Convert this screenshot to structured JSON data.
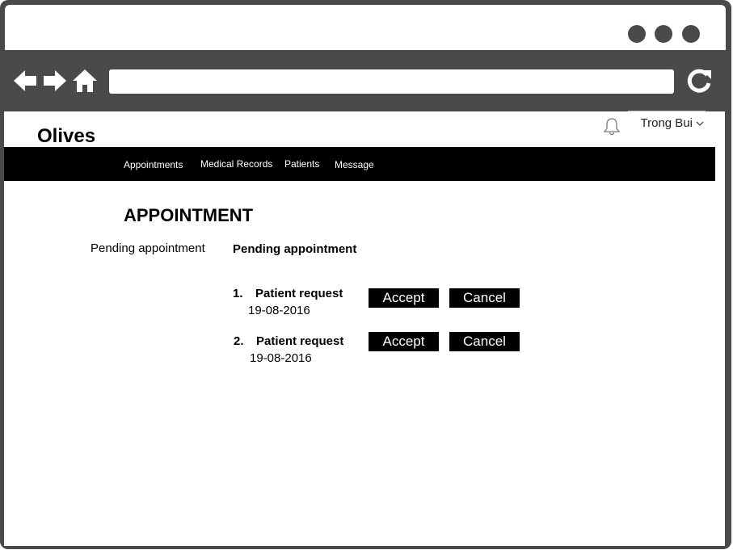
{
  "browser": {
    "window_dots": 3,
    "url_value": ""
  },
  "app": {
    "logo": "Olives",
    "user_name": "Trong Bui",
    "nav": [
      "Appointments",
      "Medical Records",
      "Patients",
      "Message"
    ]
  },
  "page": {
    "title": "APPOINTMENT",
    "side_label": "Pending appointment",
    "section_title": "Pending appointment",
    "requests": [
      {
        "number": "1.",
        "title": "Patient request",
        "date": "19-08-2016",
        "accept_label": "Accept",
        "cancel_label": "Cancel"
      },
      {
        "number": "2.",
        "title": "Patient request",
        "date": "19-08-2016",
        "accept_label": "Accept",
        "cancel_label": "Cancel"
      }
    ]
  },
  "colors": {
    "chrome": "#4a4a4a",
    "navbar": "#000000",
    "button": "#000000",
    "button_text": "#ffffff"
  },
  "icons": [
    "back-arrow-icon",
    "forward-arrow-icon",
    "home-icon",
    "reload-icon",
    "bell-icon",
    "chevron-down-icon"
  ]
}
